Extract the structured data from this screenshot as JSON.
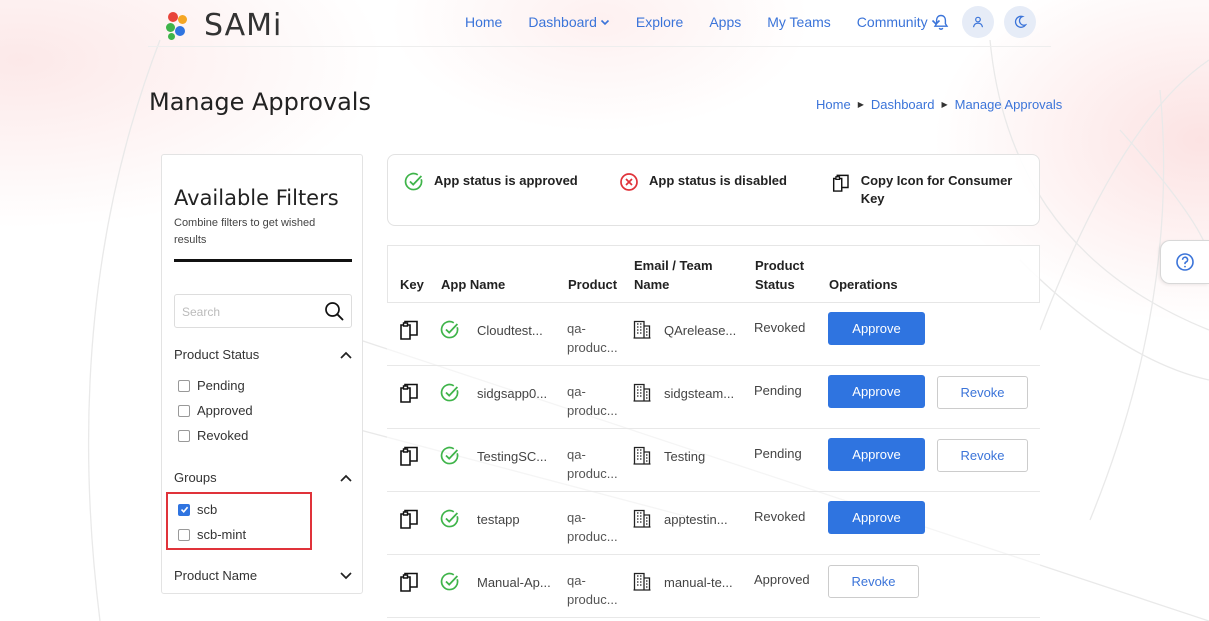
{
  "header": {
    "logo_text": "SAMi",
    "nav": [
      {
        "label": "Home"
      },
      {
        "label": "Dashboard",
        "has_dropdown": true
      },
      {
        "label": "Explore"
      },
      {
        "label": "Apps"
      },
      {
        "label": "My Teams"
      },
      {
        "label": "Community",
        "has_dropdown": true
      }
    ],
    "icons": [
      "bell-icon",
      "user-icon",
      "moon-icon"
    ]
  },
  "page": {
    "title": "Manage Approvals",
    "breadcrumb": [
      "Home",
      "Dashboard",
      "Manage Approvals"
    ]
  },
  "filters": {
    "title": "Available Filters",
    "subtitle": "Combine filters to get wished results",
    "search_placeholder": "Search",
    "product_status": {
      "label": "Product Status",
      "expanded": true,
      "options": [
        {
          "label": "Pending",
          "checked": false
        },
        {
          "label": "Approved",
          "checked": false
        },
        {
          "label": "Revoked",
          "checked": false
        }
      ]
    },
    "groups": {
      "label": "Groups",
      "expanded": true,
      "options": [
        {
          "label": "scb",
          "checked": true
        },
        {
          "label": "scb-mint",
          "checked": false
        }
      ]
    },
    "product_name": {
      "label": "Product Name",
      "expanded": false
    }
  },
  "legend": {
    "approved": "App status is approved",
    "disabled": "App status is disabled",
    "copy": "Copy Icon for Consumer Key"
  },
  "table": {
    "columns": {
      "key": "Key",
      "app_name": "App Name",
      "product": "Product",
      "email_team": "Email / Team Name",
      "product_status": "Product Status",
      "operations": "Operations"
    },
    "rows": [
      {
        "app_name": "Cloudtest...",
        "product": "qa-produc...",
        "team": "QArelease...",
        "status": "Revoked",
        "approve": "Approve",
        "revoke": ""
      },
      {
        "app_name": "sidgsapp0...",
        "product": "qa-produc...",
        "team": "sidgsteam...",
        "status": "Pending",
        "approve": "Approve",
        "revoke": "Revoke"
      },
      {
        "app_name": "TestingSC...",
        "product": "qa-produc...",
        "team": "Testing",
        "status": "Pending",
        "approve": "Approve",
        "revoke": "Revoke"
      },
      {
        "app_name": "testapp",
        "product": "qa-produc...",
        "team": "apptestin...",
        "status": "Revoked",
        "approve": "Approve",
        "revoke": ""
      },
      {
        "app_name": "Manual-Ap...",
        "product": "qa-produc...",
        "team": "manual-te...",
        "status": "Approved",
        "approve": "",
        "revoke": "Revoke"
      }
    ]
  },
  "colors": {
    "primary": "#2f74e0",
    "link": "#3b74d9",
    "approved_green": "#3fb44a",
    "disabled_red": "#e0333a",
    "highlight_box": "#e0333a"
  }
}
